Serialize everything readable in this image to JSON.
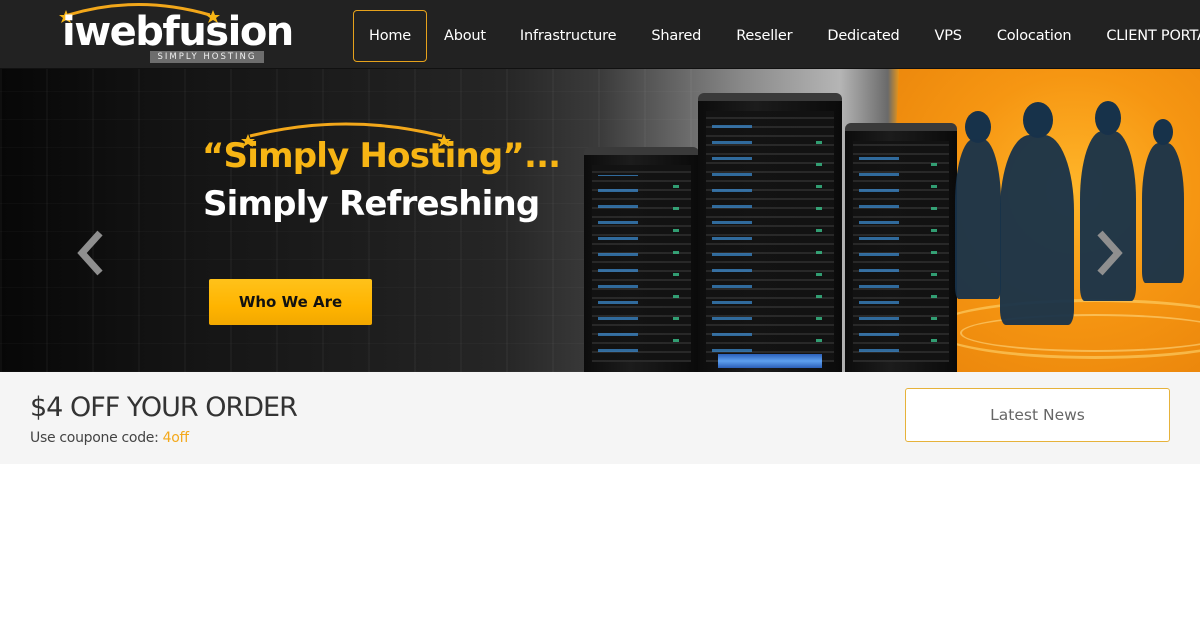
{
  "brand": {
    "name": "iwebfusion",
    "tagline": "SIMPLY HOSTING",
    "accent_color": "#f7b514",
    "nav_bg": "#222222"
  },
  "nav": {
    "items": [
      {
        "label": "Home",
        "active": true
      },
      {
        "label": "About"
      },
      {
        "label": "Infrastructure"
      },
      {
        "label": "Shared"
      },
      {
        "label": "Reseller"
      },
      {
        "label": "Dedicated"
      },
      {
        "label": "VPS"
      },
      {
        "label": "Colocation"
      },
      {
        "label": "CLIENT PORTAL"
      }
    ]
  },
  "hero": {
    "headline_1": "“Simply Hosting”...",
    "headline_2": "Simply Refreshing",
    "cta_label": "Who We Are",
    "prev_icon": "chevron-left-icon",
    "next_icon": "chevron-right-icon"
  },
  "promo": {
    "title": "$4 OFF YOUR ORDER",
    "subtitle_prefix": "Use coupone code: ",
    "code": "4off",
    "news_button": "Latest News"
  }
}
